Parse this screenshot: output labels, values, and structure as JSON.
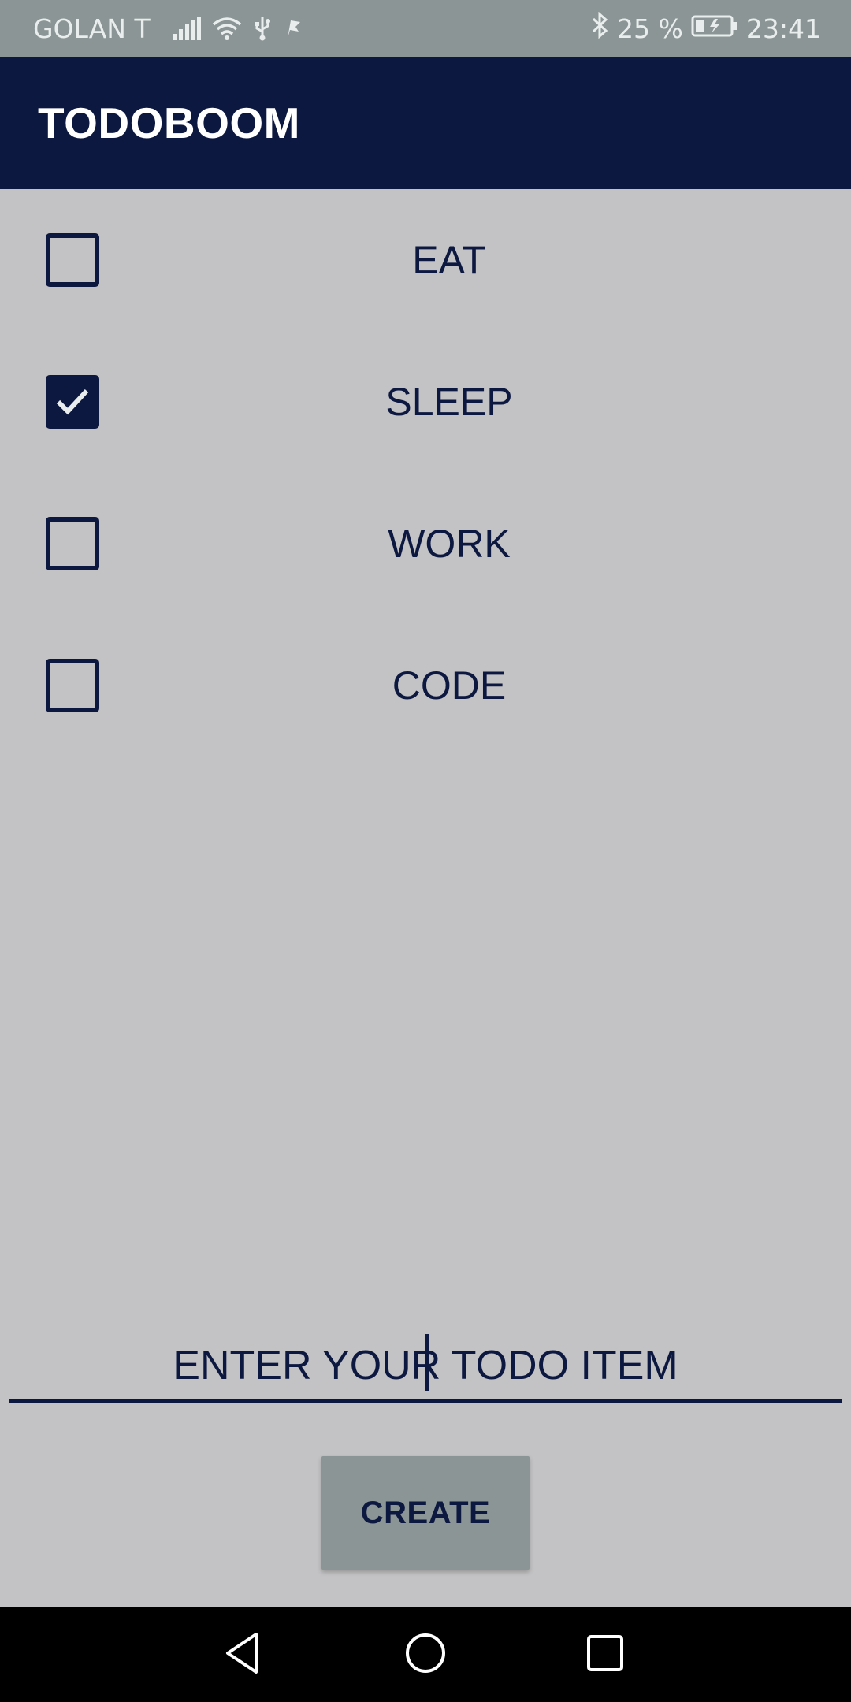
{
  "status_bar": {
    "carrier": "GOLAN T",
    "battery": "25 %",
    "time": "23:41",
    "icons": [
      "signal-icon",
      "wifi-icon",
      "usb-icon",
      "flag-icon",
      "bluetooth-icon",
      "battery-charging-icon"
    ]
  },
  "app_bar": {
    "title": "TODOBOOM"
  },
  "todos": [
    {
      "label": "EAT",
      "checked": false
    },
    {
      "label": "SLEEP",
      "checked": true
    },
    {
      "label": "WORK",
      "checked": false
    },
    {
      "label": "CODE",
      "checked": false
    }
  ],
  "input": {
    "placeholder": "ENTER YOUR TODO ITEM",
    "value": ""
  },
  "create_button": {
    "label": "CREATE"
  },
  "nav_bar": {
    "icons": [
      "back-icon",
      "home-icon",
      "recents-icon"
    ]
  },
  "colors": {
    "primary": "#0c1840",
    "background": "#c3c3c5",
    "status_bar": "#8b9595",
    "button": "#8b9595"
  }
}
